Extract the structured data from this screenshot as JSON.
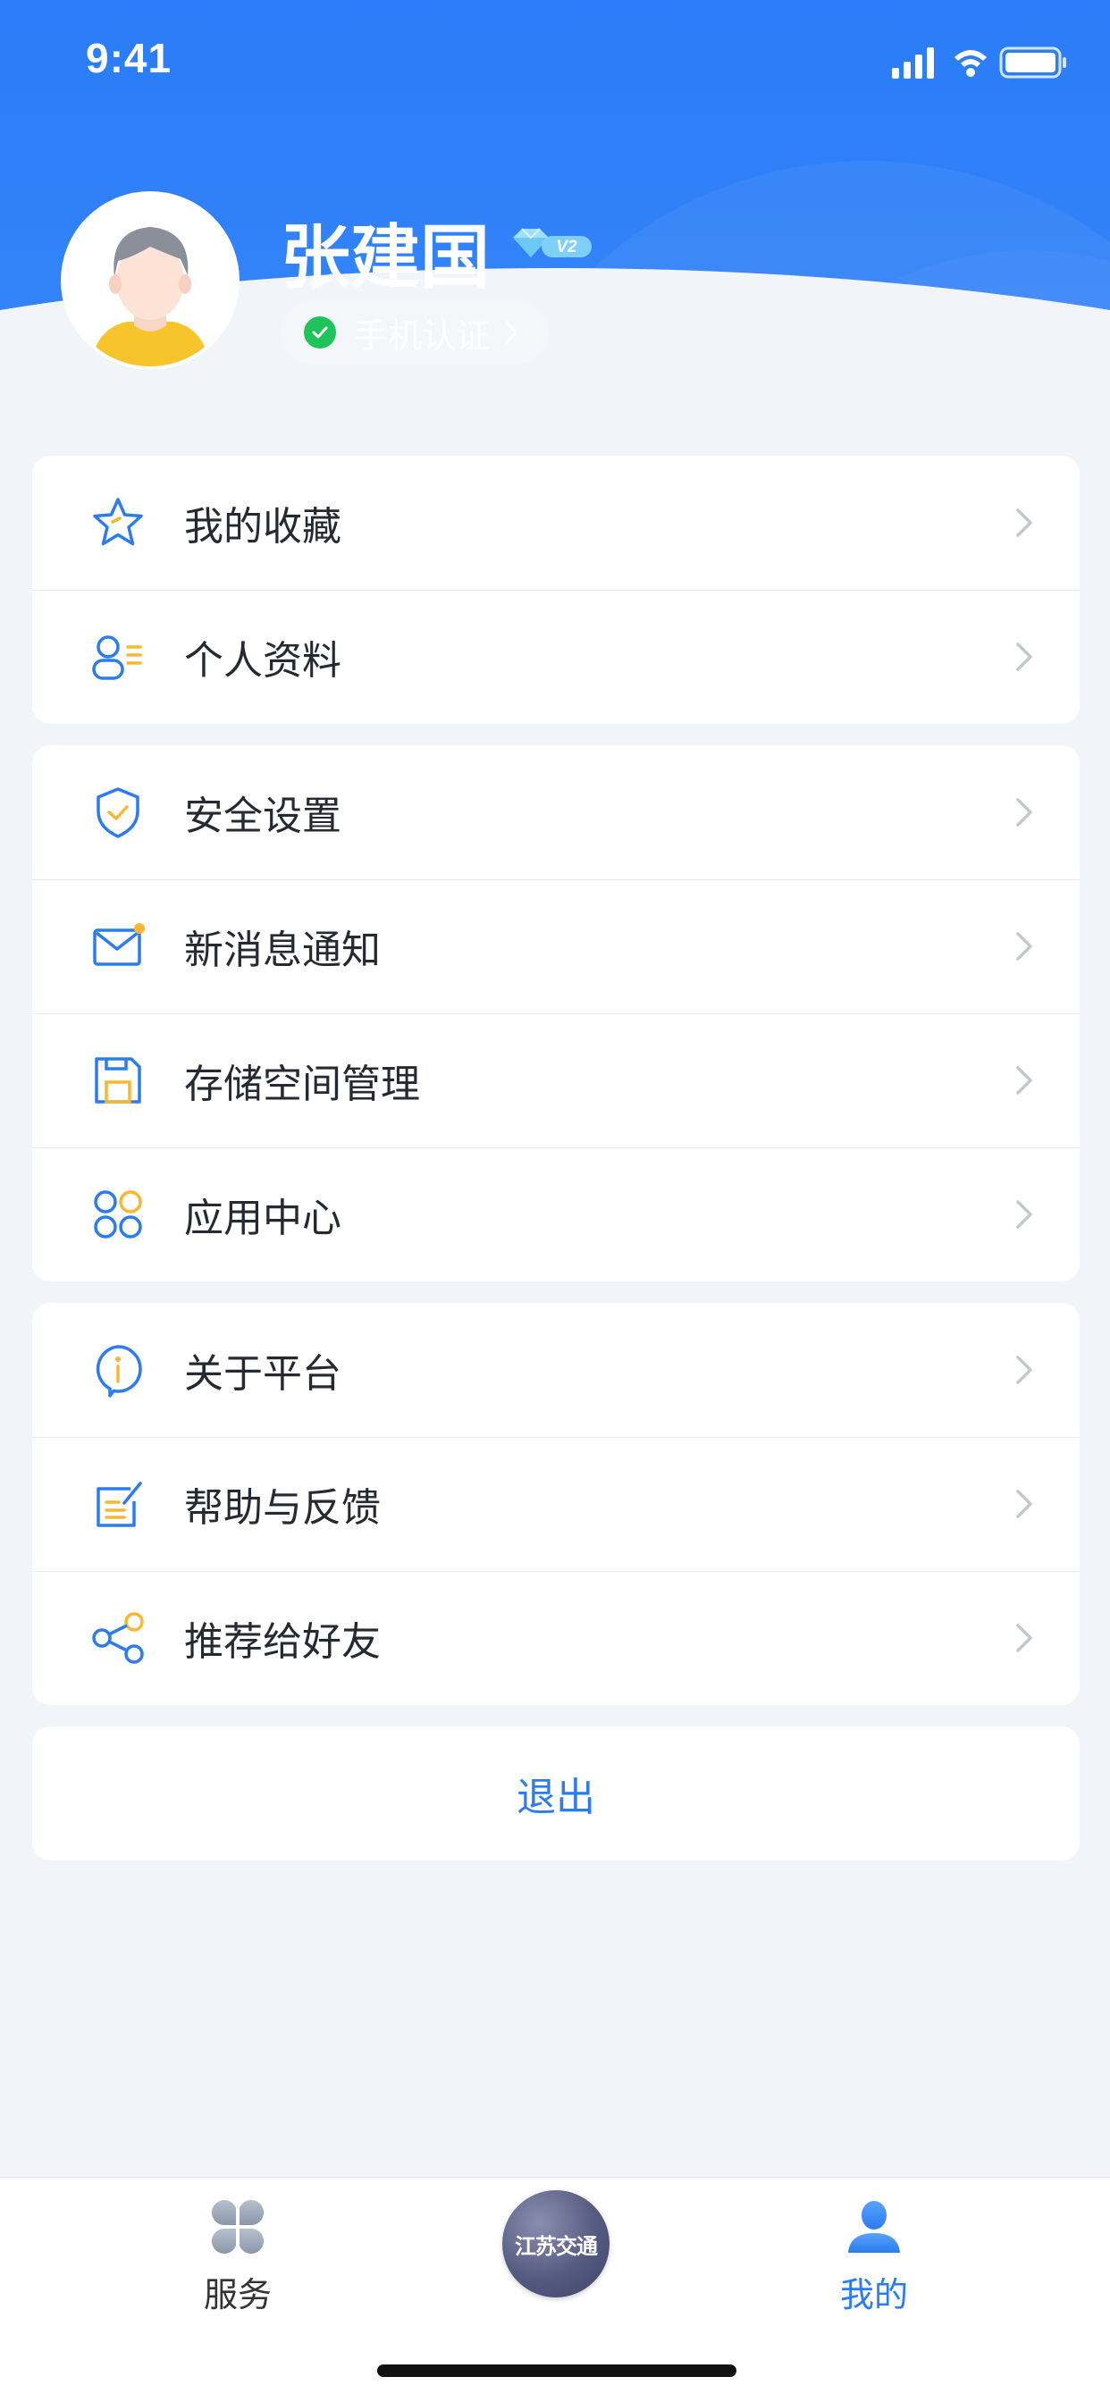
{
  "status_bar": {
    "time": "9:41"
  },
  "profile": {
    "name": "张建国",
    "vip_level": "V2",
    "auth_label": "手机认证"
  },
  "menu_groups": [
    {
      "items": [
        {
          "icon": "star-icon",
          "label": "我的收藏"
        },
        {
          "icon": "user-card-icon",
          "label": "个人资料"
        }
      ]
    },
    {
      "items": [
        {
          "icon": "shield-icon",
          "label": "安全设置"
        },
        {
          "icon": "mail-icon",
          "label": "新消息通知"
        },
        {
          "icon": "save-icon",
          "label": "存储空间管理"
        },
        {
          "icon": "apps-icon",
          "label": "应用中心"
        }
      ]
    },
    {
      "items": [
        {
          "icon": "info-icon",
          "label": "关于平台"
        },
        {
          "icon": "feedback-icon",
          "label": "帮助与反馈"
        },
        {
          "icon": "share-icon",
          "label": "推荐给好友"
        }
      ]
    }
  ],
  "logout_label": "退出",
  "tabbar": {
    "service_label": "服务",
    "center_label": "江苏交通",
    "mine_label": "我的"
  },
  "colors": {
    "primary": "#2a7cf0",
    "header": "#2a7cf8",
    "accent_yellow": "#f7b731",
    "success": "#1ec35a"
  }
}
